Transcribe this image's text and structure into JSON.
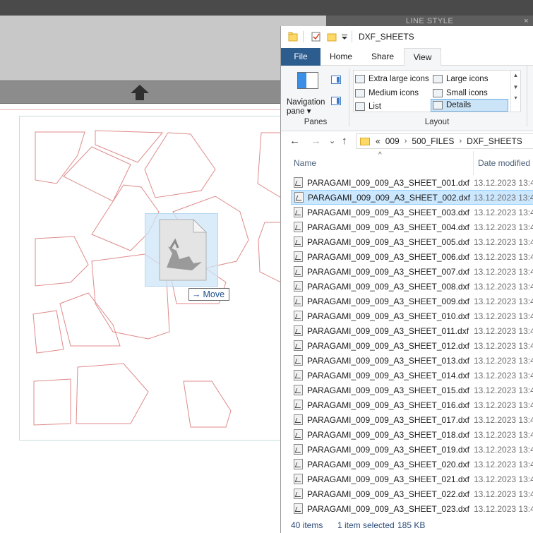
{
  "background_app": {
    "panel_title": "LINE STYLE",
    "panel_close": "×",
    "drag_tooltip": {
      "arrow": "→",
      "label": "Move"
    }
  },
  "explorer": {
    "title": "DXF_SHEETS",
    "tabs": [
      "File",
      "Home",
      "Share",
      "View"
    ],
    "active_tab": "View",
    "ribbon": {
      "navigation_pane_label": "Navigation pane",
      "navigation_pane_caret": "▾",
      "panes_group": "Panes",
      "layout_group": "Layout",
      "layout_options": [
        "Extra large icons",
        "Large icons",
        "Medium icons",
        "Small icons",
        "List",
        "Details"
      ],
      "selected_layout": "Details"
    },
    "address": {
      "back": "←",
      "forward": "→",
      "dropdown": "⌄",
      "up": "↑",
      "overflow": "«",
      "segments": [
        "009",
        "500_FILES",
        "DXF_SHEETS"
      ],
      "separator": "›"
    },
    "columns": {
      "name": "Name",
      "date_modified": "Date modified",
      "sort_indicator": "^"
    },
    "files": [
      {
        "name": "PARAGAMI_009_009_A3_SHEET_001.dxf",
        "date": "13.12.2023 13:4"
      },
      {
        "name": "PARAGAMI_009_009_A3_SHEET_002.dxf",
        "date": "13.12.2023 13:4",
        "selected": true
      },
      {
        "name": "PARAGAMI_009_009_A3_SHEET_003.dxf",
        "date": "13.12.2023 13:4"
      },
      {
        "name": "PARAGAMI_009_009_A3_SHEET_004.dxf",
        "date": "13.12.2023 13:4"
      },
      {
        "name": "PARAGAMI_009_009_A3_SHEET_005.dxf",
        "date": "13.12.2023 13:4"
      },
      {
        "name": "PARAGAMI_009_009_A3_SHEET_006.dxf",
        "date": "13.12.2023 13:4"
      },
      {
        "name": "PARAGAMI_009_009_A3_SHEET_007.dxf",
        "date": "13.12.2023 13:4"
      },
      {
        "name": "PARAGAMI_009_009_A3_SHEET_008.dxf",
        "date": "13.12.2023 13:4"
      },
      {
        "name": "PARAGAMI_009_009_A3_SHEET_009.dxf",
        "date": "13.12.2023 13:4"
      },
      {
        "name": "PARAGAMI_009_009_A3_SHEET_010.dxf",
        "date": "13.12.2023 13:4"
      },
      {
        "name": "PARAGAMI_009_009_A3_SHEET_011.dxf",
        "date": "13.12.2023 13:4"
      },
      {
        "name": "PARAGAMI_009_009_A3_SHEET_012.dxf",
        "date": "13.12.2023 13:4"
      },
      {
        "name": "PARAGAMI_009_009_A3_SHEET_013.dxf",
        "date": "13.12.2023 13:4"
      },
      {
        "name": "PARAGAMI_009_009_A3_SHEET_014.dxf",
        "date": "13.12.2023 13:4"
      },
      {
        "name": "PARAGAMI_009_009_A3_SHEET_015.dxf",
        "date": "13.12.2023 13:4"
      },
      {
        "name": "PARAGAMI_009_009_A3_SHEET_016.dxf",
        "date": "13.12.2023 13:4"
      },
      {
        "name": "PARAGAMI_009_009_A3_SHEET_017.dxf",
        "date": "13.12.2023 13:4"
      },
      {
        "name": "PARAGAMI_009_009_A3_SHEET_018.dxf",
        "date": "13.12.2023 13:4"
      },
      {
        "name": "PARAGAMI_009_009_A3_SHEET_019.dxf",
        "date": "13.12.2023 13:4"
      },
      {
        "name": "PARAGAMI_009_009_A3_SHEET_020.dxf",
        "date": "13.12.2023 13:4"
      },
      {
        "name": "PARAGAMI_009_009_A3_SHEET_021.dxf",
        "date": "13.12.2023 13:4"
      },
      {
        "name": "PARAGAMI_009_009_A3_SHEET_022.dxf",
        "date": "13.12.2023 13:4"
      },
      {
        "name": "PARAGAMI_009_009_A3_SHEET_023.dxf",
        "date": "13.12.2023 13:4"
      }
    ],
    "status": {
      "count": "40 items",
      "selection": "1 item selected",
      "size": "185 KB"
    }
  },
  "colors": {
    "accent": "#2d5c8f",
    "selection": "#cce8ff",
    "shape_stroke": "#e08a8a"
  }
}
